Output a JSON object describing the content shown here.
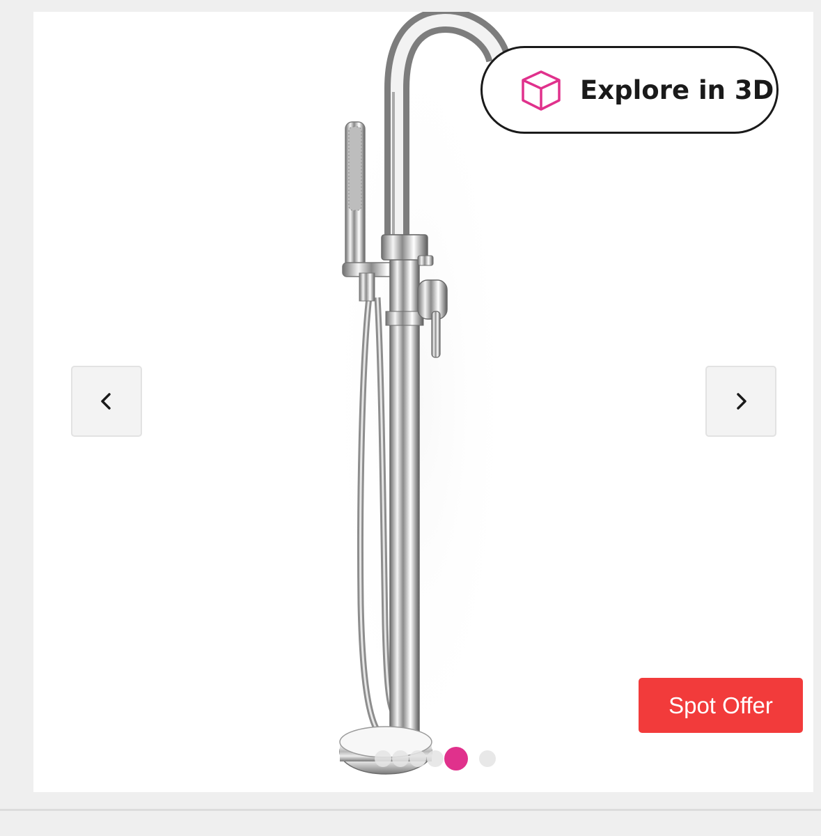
{
  "gallery": {
    "product_image_alt": "Freestanding bath mixer tap with hand shower",
    "explore_3d": {
      "label": "Explore in 3D",
      "icon": "cube-icon",
      "icon_color": "#e0318c"
    },
    "prev_button": {
      "icon": "chevron-left-icon"
    },
    "next_button": {
      "icon": "chevron-right-icon"
    },
    "spot_offer": {
      "label": "Spot Offer",
      "color": "#f23b3b"
    },
    "pagination": {
      "count": 6,
      "active_index": 4,
      "active_color": "#e0318c"
    }
  }
}
